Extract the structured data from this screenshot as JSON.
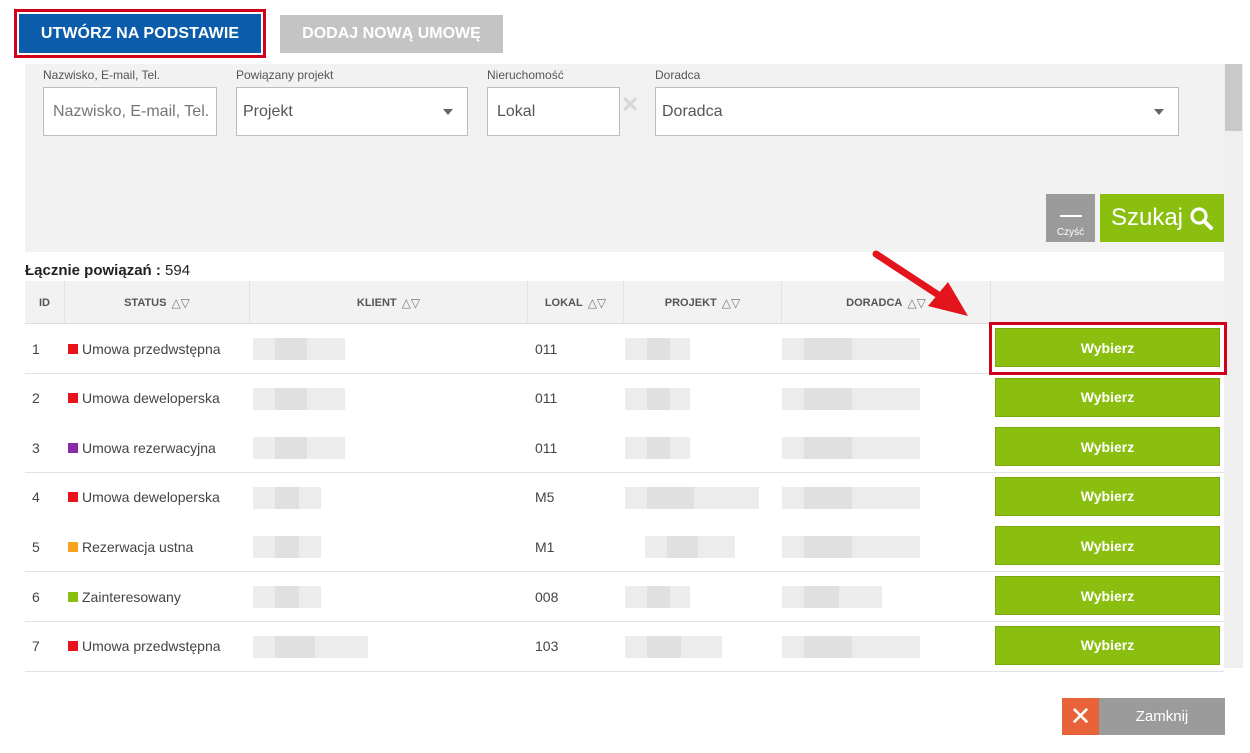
{
  "top_buttons": {
    "create_based": "UTWÓRZ NA PODSTAWIE",
    "add_new": "DODAJ NOWĄ UMOWĘ"
  },
  "filters": {
    "name": {
      "label": "Nazwisko, E-mail, Tel.",
      "placeholder": "Nazwisko, E-mail, Tel."
    },
    "project": {
      "label": "Powiązany projekt",
      "value": "Projekt"
    },
    "property": {
      "label": "Nieruchomość",
      "value": "Lokal"
    },
    "advisor": {
      "label": "Doradca",
      "value": "Doradca"
    },
    "clear_label": "Czyść",
    "search_label": "Szukaj"
  },
  "total": {
    "label": "Łącznie powiązań :",
    "count": "594"
  },
  "table": {
    "headers": {
      "id": "ID",
      "status": "STATUS",
      "client": "KLIENT",
      "unit": "LOKAL",
      "project": "PROJEKT",
      "advisor": "DORADCA"
    },
    "rows": [
      {
        "id": "1",
        "status": "Umowa przedwstępna",
        "status_color": "#e8141b",
        "unit": "011",
        "action": "Wybierz"
      },
      {
        "id": "2",
        "status": "Umowa deweloperska",
        "status_color": "#e8141b",
        "unit": "011",
        "action": "Wybierz"
      },
      {
        "id": "3",
        "status": "Umowa rezerwacyjna",
        "status_color": "#8a2ba8",
        "unit": "011",
        "action": "Wybierz"
      },
      {
        "id": "4",
        "status": "Umowa deweloperska",
        "status_color": "#e8141b",
        "unit": "M5",
        "action": "Wybierz"
      },
      {
        "id": "5",
        "status": "Rezerwacja ustna",
        "status_color": "#f7a31c",
        "unit": "M1",
        "action": "Wybierz"
      },
      {
        "id": "6",
        "status": "Zainteresowany",
        "status_color": "#8bbf0f",
        "unit": "008",
        "action": "Wybierz"
      },
      {
        "id": "7",
        "status": "Umowa przedwstępna",
        "status_color": "#e8141b",
        "unit": "103",
        "action": "Wybierz"
      }
    ]
  },
  "footer": {
    "close_label": "Zamknij"
  },
  "colors": {
    "primary": "#0b5cab",
    "accent_green": "#8bbf0f",
    "highlight_red": "#d0021b",
    "close_orange": "#e8623a"
  }
}
